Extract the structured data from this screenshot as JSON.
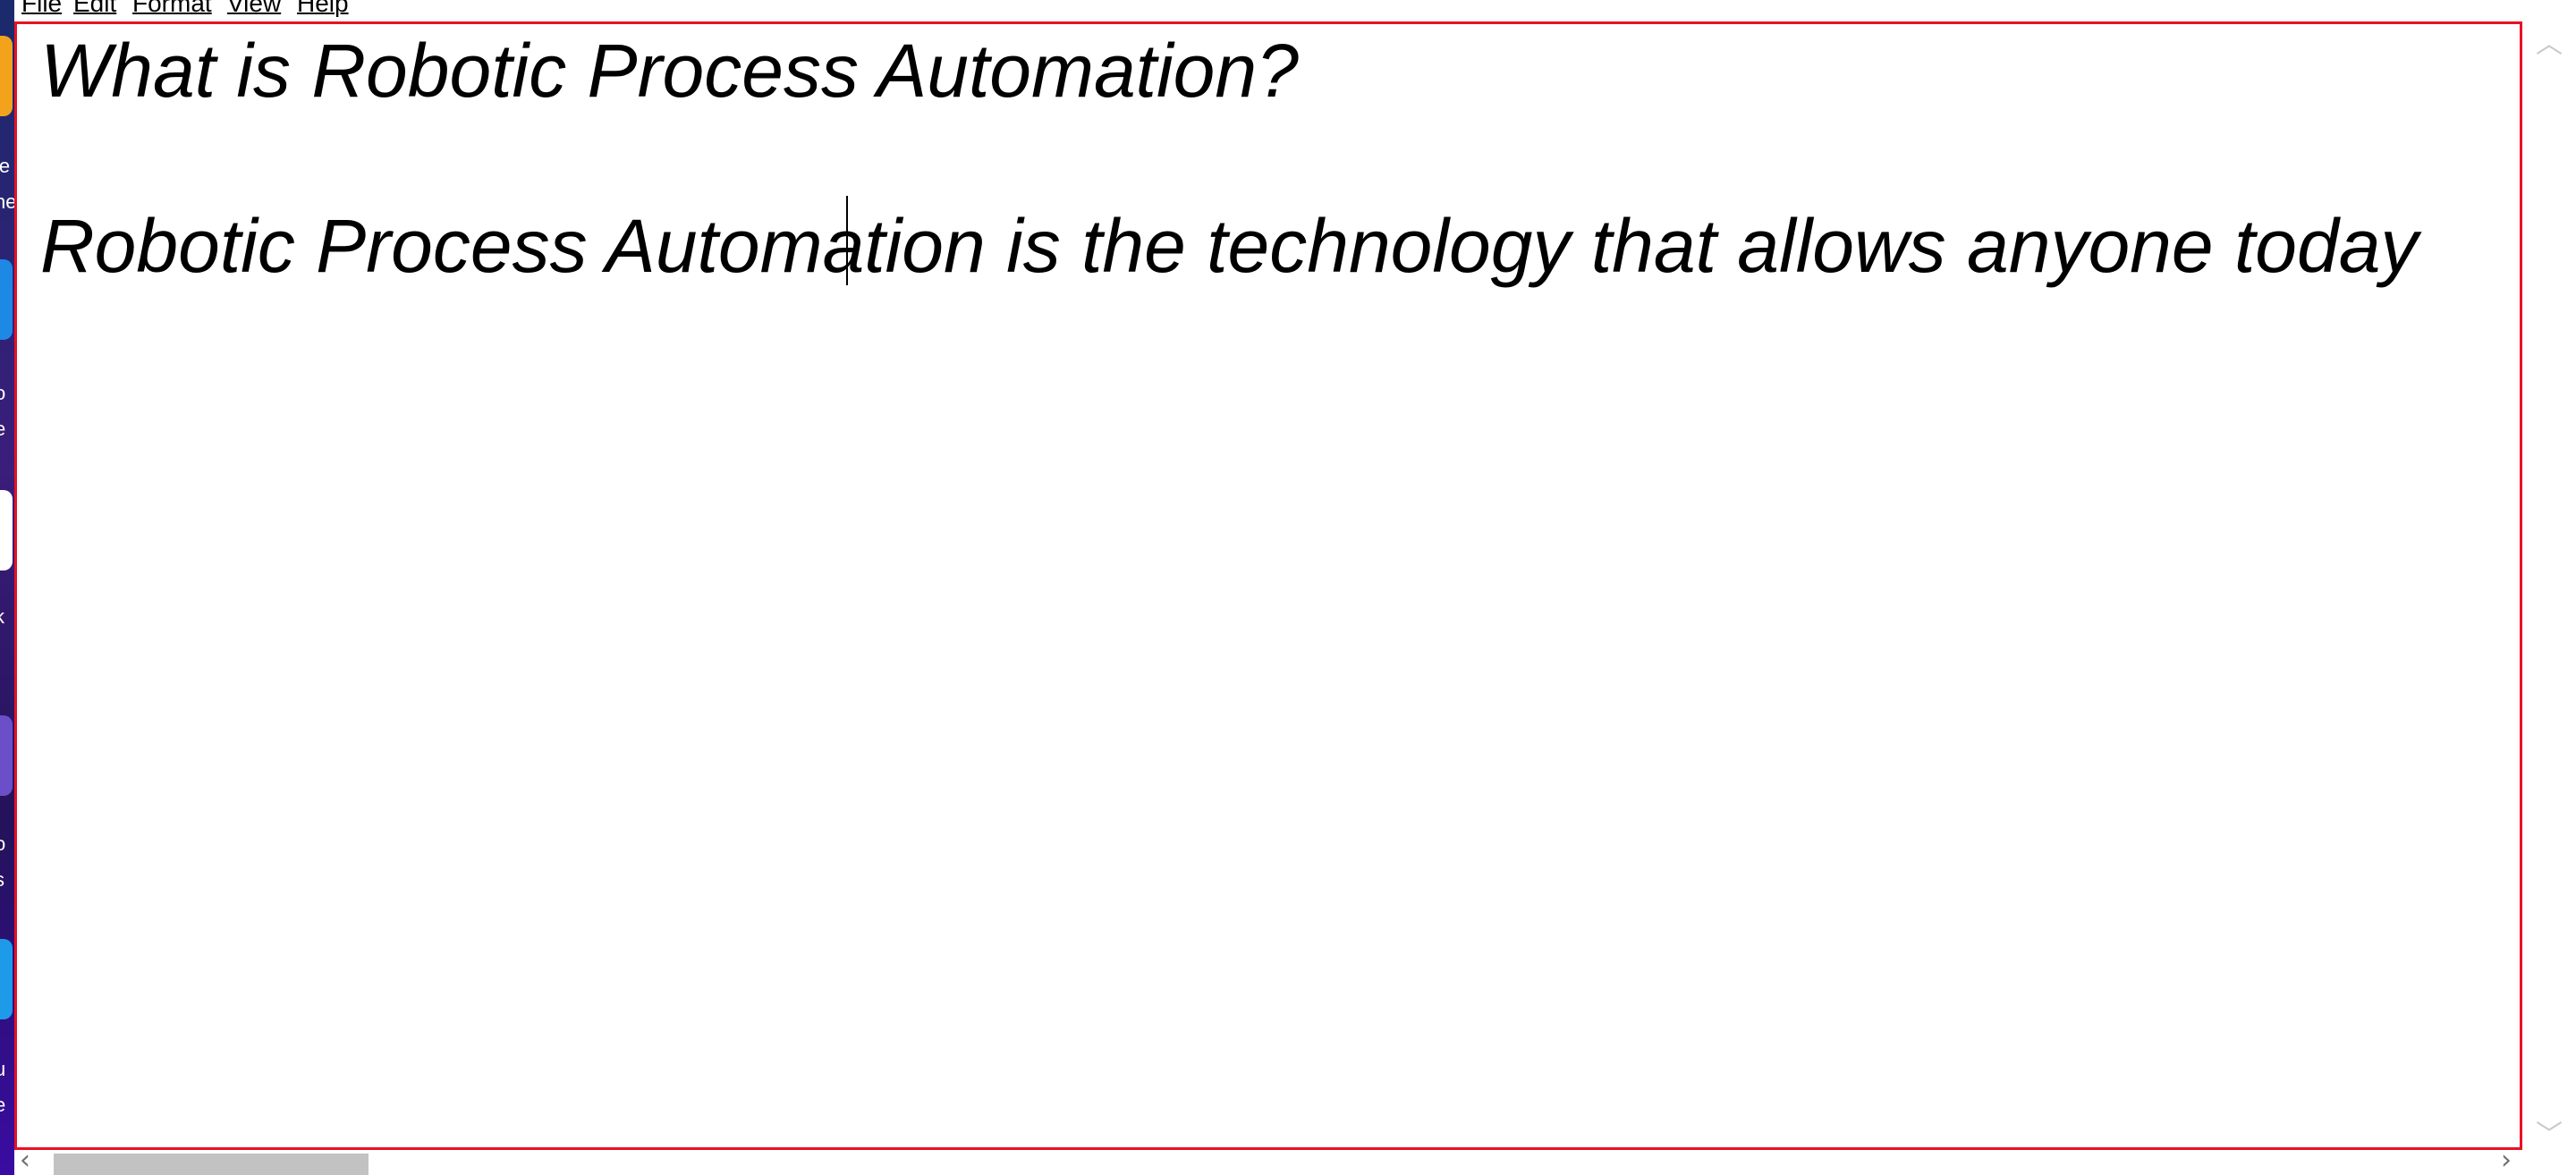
{
  "menubar": {
    "items": [
      {
        "label": "File"
      },
      {
        "label": "Edit"
      },
      {
        "label": "Format"
      },
      {
        "label": "View"
      },
      {
        "label": "Help"
      }
    ]
  },
  "editor": {
    "lines": [
      "What is Robotic Process Automation?",
      "",
      "Robotic Process Automation is the technology that allows anyone today"
    ],
    "font_style": "italic",
    "border_color": "#e81123"
  },
  "scrollbars": {
    "up_icon": "chevron-up-icon",
    "down_icon": "chevron-down-icon",
    "left_icon": "chevron-left-icon",
    "right_icon": "chevron-right-icon"
  },
  "desktop": {
    "label_fragments": [
      "le",
      "he",
      "o",
      "e",
      "k",
      "o",
      "s",
      "u",
      "e"
    ]
  }
}
